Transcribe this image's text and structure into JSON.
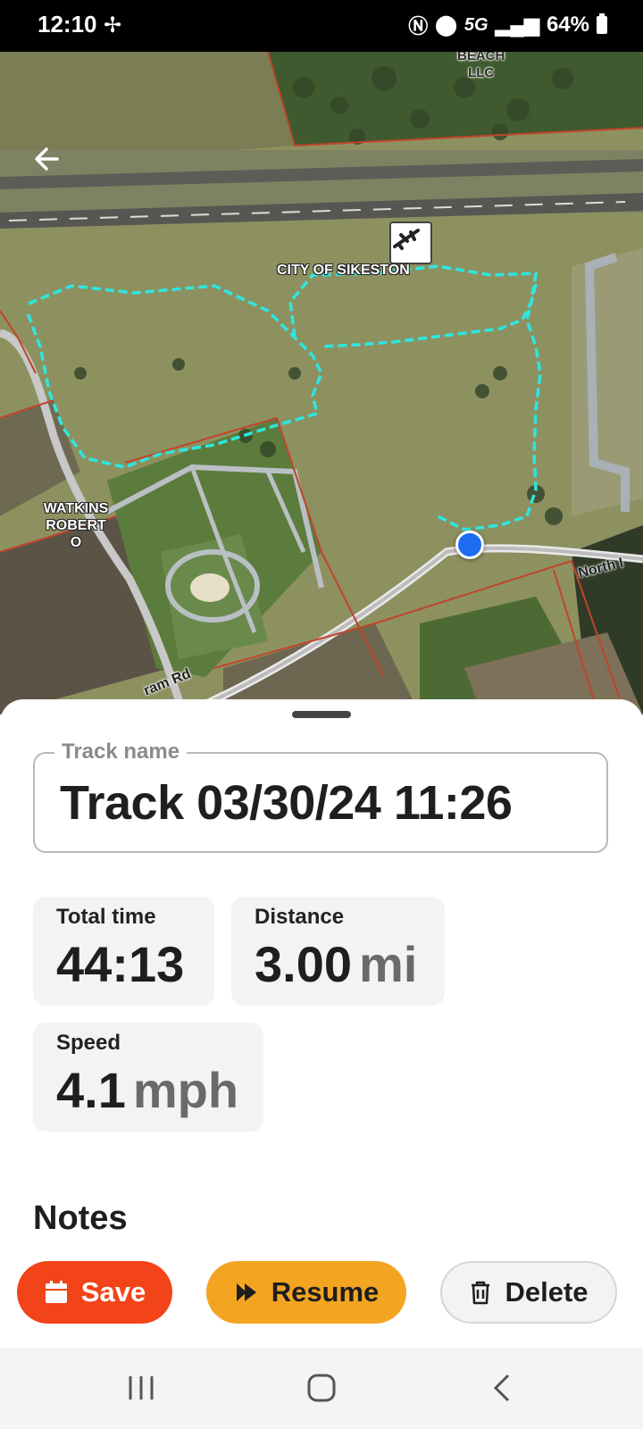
{
  "status_bar": {
    "time": "12:10",
    "network": "5G",
    "battery": "64%"
  },
  "map": {
    "labels": {
      "beach_llc": "BEACH\nLLC",
      "city": "CITY OF SIKESTON",
      "watkins": "WATKINS\nROBERT\nO",
      "road_north": "North I",
      "road_ram": "ram Rd"
    },
    "track_color": "#2ee6e0",
    "location_color": "#1d6cf0"
  },
  "sheet": {
    "track_name_label": "Track name",
    "track_name_value": "Track 03/30/24 11:26",
    "stats": {
      "total_time": {
        "label": "Total time",
        "value": "44:13"
      },
      "distance": {
        "label": "Distance",
        "value": "3.00",
        "unit": "mi"
      },
      "speed": {
        "label": "Speed",
        "value": "4.1",
        "unit": "mph"
      }
    },
    "notes_title": "Notes",
    "buttons": {
      "save": "Save",
      "resume": "Resume",
      "delete": "Delete"
    }
  },
  "colors": {
    "save": "#f24418",
    "resume": "#f3a522",
    "delete_bg": "#f3f3f3"
  }
}
